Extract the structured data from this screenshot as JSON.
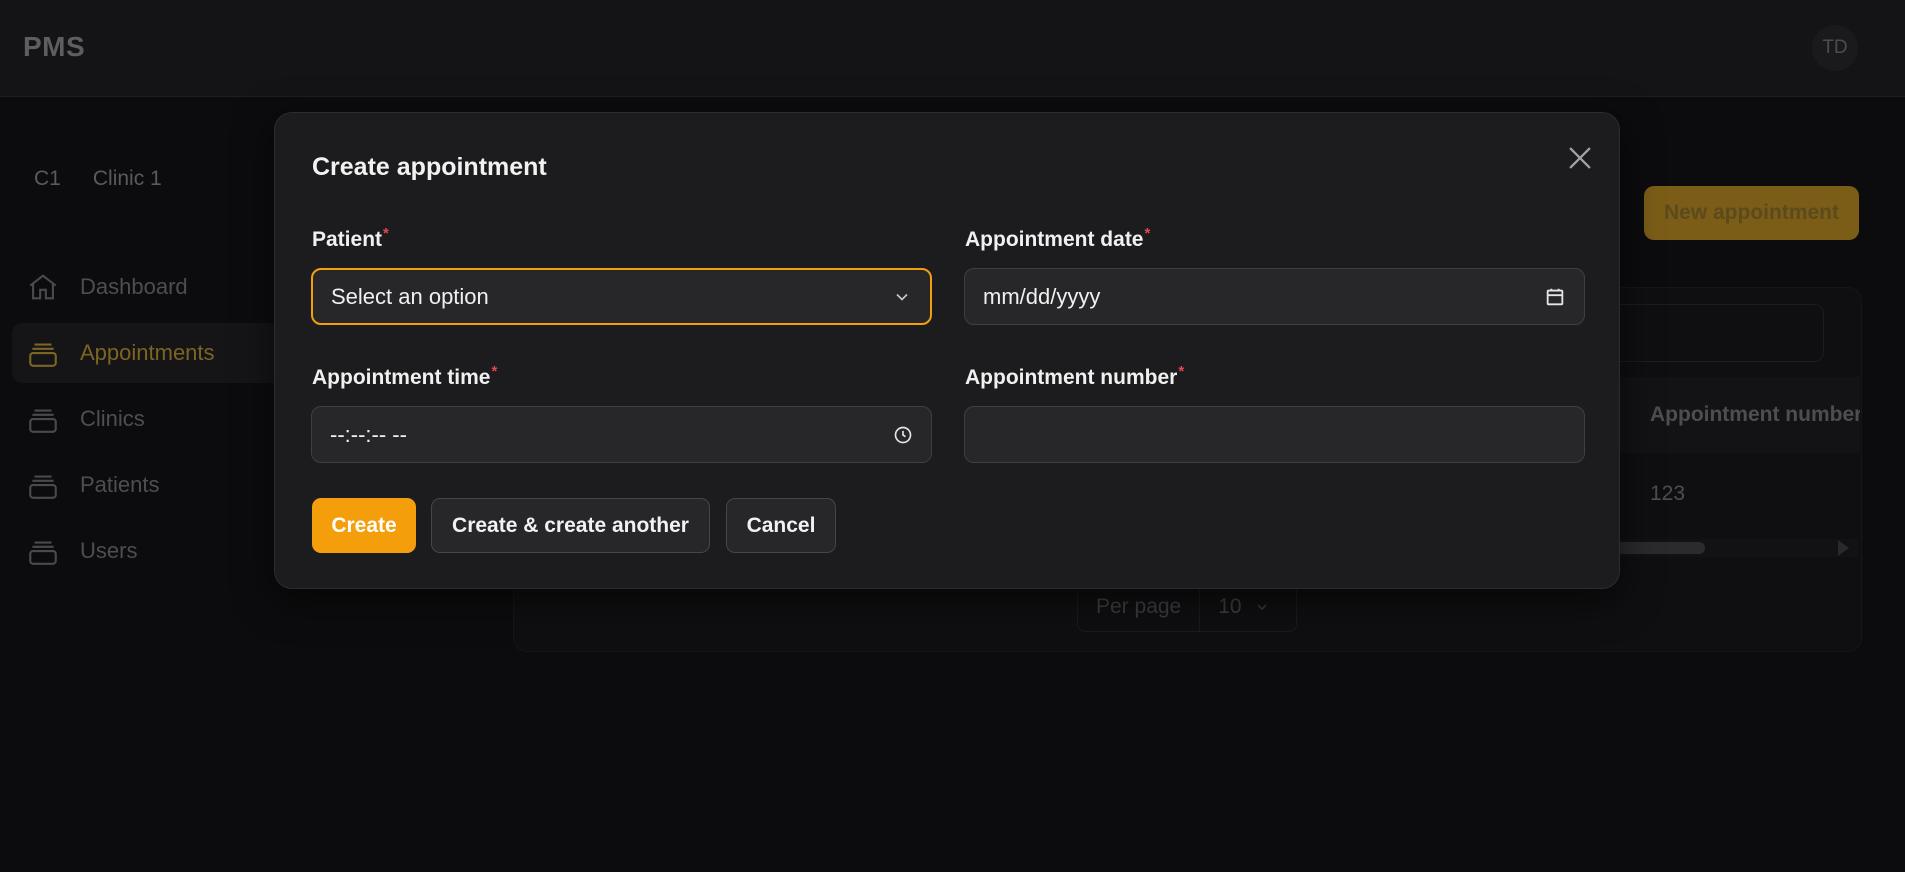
{
  "app": {
    "brand": "PMS",
    "user_initials": "TD"
  },
  "sidebar": {
    "tenant_code": "C1",
    "tenant_name": "Clinic 1",
    "items": [
      {
        "label": "Dashboard",
        "icon": "home-icon",
        "active": false
      },
      {
        "label": "Appointments",
        "icon": "stack-icon",
        "active": true
      },
      {
        "label": "Clinics",
        "icon": "stack-icon",
        "active": false
      },
      {
        "label": "Patients",
        "icon": "stack-icon",
        "active": false
      },
      {
        "label": "Users",
        "icon": "stack-icon",
        "active": false
      }
    ]
  },
  "page": {
    "new_button": "New appointment",
    "table": {
      "column_header": "Appointment number",
      "row_value": "123"
    },
    "pagination": {
      "per_page_label": "Per page",
      "per_page_value": "10"
    }
  },
  "modal": {
    "title": "Create appointment",
    "fields": {
      "patient": {
        "label": "Patient",
        "value": "Select an option"
      },
      "date": {
        "label": "Appointment date",
        "value": "mm/dd/yyyy"
      },
      "time": {
        "label": "Appointment time",
        "value": "--:--:-- --"
      },
      "number": {
        "label": "Appointment number",
        "value": ""
      }
    },
    "required_mark": "*",
    "buttons": {
      "create": "Create",
      "create_another": "Create & create another",
      "cancel": "Cancel"
    }
  },
  "colors": {
    "accent": "#f59e0b",
    "required": "#e5484d",
    "modal_bg": "#1c1c1e"
  }
}
